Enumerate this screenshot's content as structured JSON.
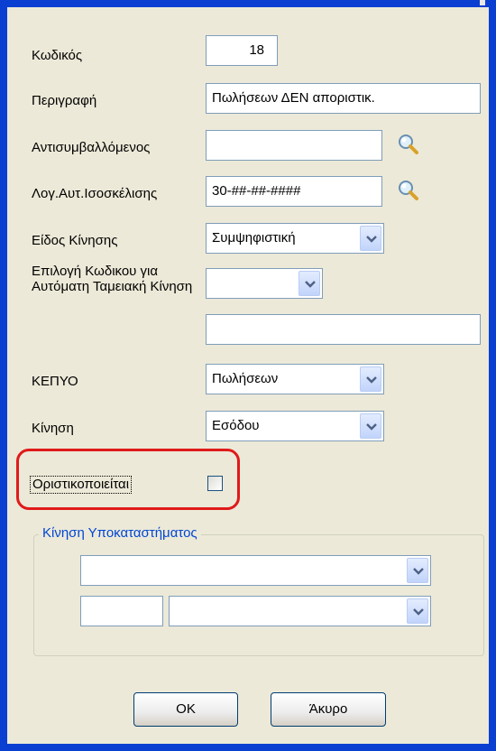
{
  "form": {
    "code_label": "Κωδικός",
    "code_value": "18",
    "description_label": "Περιγραφή",
    "description_value": "Πωλήσεων ΔΕΝ αποριστικ.",
    "counterparty_label": "Αντισυμβαλλόμενος",
    "counterparty_value": "",
    "balancing_account_label": "Λογ.Αυτ.Ισοσκέλισης",
    "balancing_account_value": "30-##-##-####",
    "movement_type_label": "Είδος Κίνησης",
    "movement_type_value": "Συμψηφιστική",
    "auto_cash_label": "Επιλογή Κωδικου για Αυτόματη Ταμειακή Κίνηση",
    "auto_cash_select_value": "",
    "auto_cash_text_value": "",
    "kepyo_label": "ΚΕΠΥΟ",
    "kepyo_value": "Πωλήσεων",
    "movement_label": "Κίνηση",
    "movement_value": "Εσόδου",
    "finalized_label": "Οριστικοποιείται",
    "finalized_checked": false
  },
  "branch_group": {
    "title": "Κίνηση Υποκαταστήματος",
    "select1_value": "",
    "small_text_value": "",
    "select2_value": ""
  },
  "buttons": {
    "ok_label": "OK",
    "cancel_label": "Άκυρο"
  },
  "icons": {
    "search": "magnifier-icon",
    "dropdown": "chevron-down-icon"
  },
  "colors": {
    "dialog_bg": "#ece9d8",
    "window_frame": "#0a3fd2",
    "highlight": "#e01a1a",
    "group_title": "#0046d5"
  }
}
